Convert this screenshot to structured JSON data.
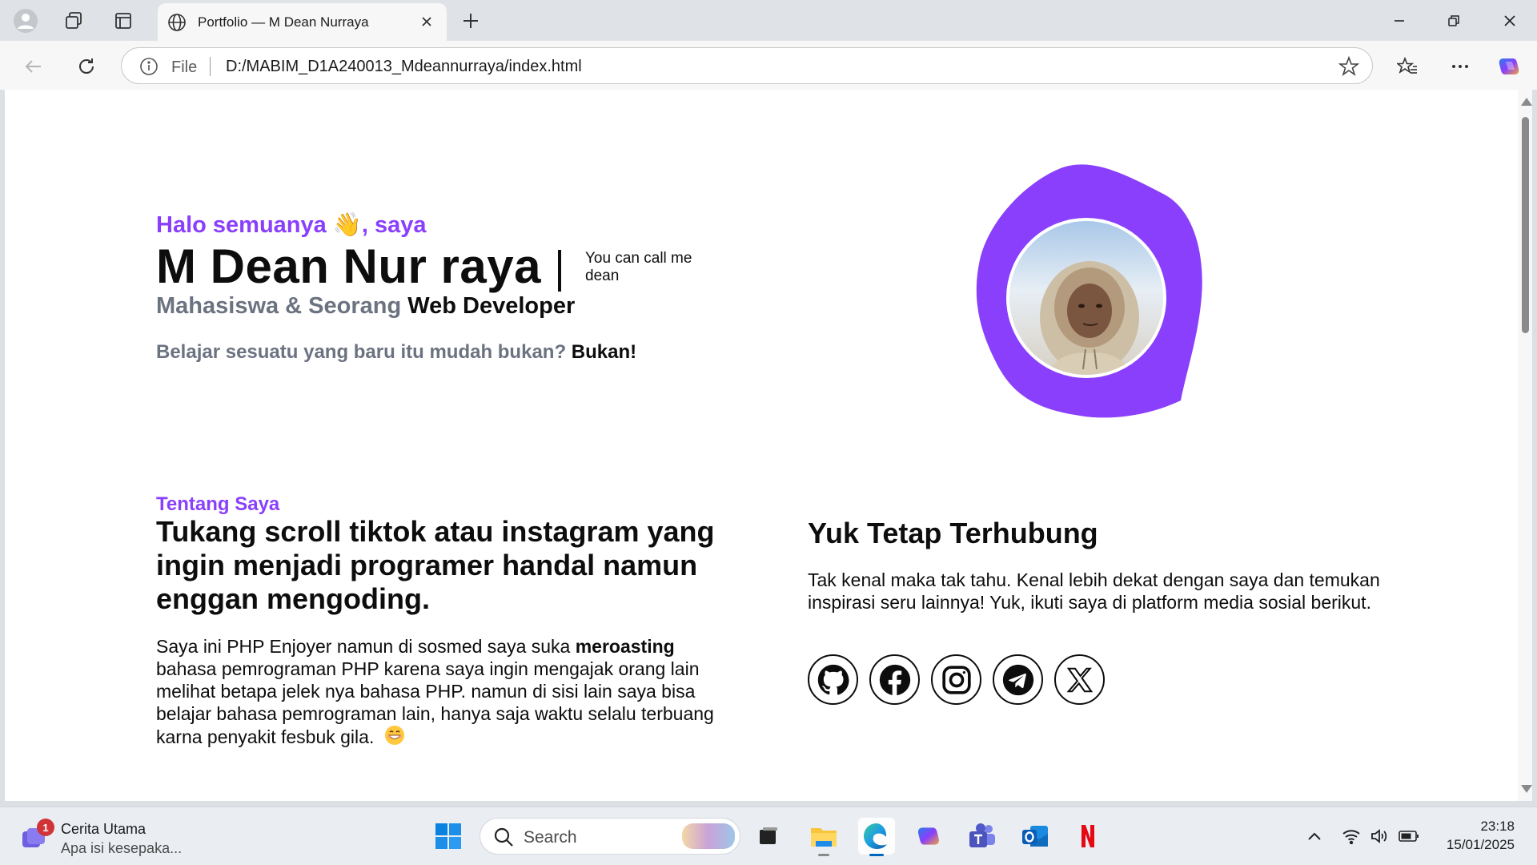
{
  "browser": {
    "tab_title": "Portfolio — M Dean Nurraya",
    "address_scheme": "File",
    "url": "D:/MABIM_D1A240013_Mdeannurraya/index.html",
    "icons": [
      "profile-icon",
      "workspaces-icon",
      "tab-actions-icon",
      "globe-icon",
      "close-icon",
      "plus-icon",
      "minimize-icon",
      "restore-icon",
      "window-close-icon",
      "back-icon",
      "refresh-icon",
      "info-icon",
      "star-icon",
      "favorites-icon",
      "more-icon",
      "copilot-icon"
    ]
  },
  "hero": {
    "greeting": "Halo semuanya 👋, saya",
    "name": "M Dean Nur raya",
    "nickname": "You can call me dean",
    "role_prefix": "Mahasiswa & Seorang",
    "role_highlight": "Web Developer",
    "quote_prefix": "Belajar sesuatu yang baru itu mudah bukan?",
    "quote_highlight": "Bukan!",
    "accent_color": "#8a3ffc"
  },
  "about": {
    "label": "Tentang Saya",
    "title": "Tukang scroll tiktok atau instagram yang ingin menjadi programer handal namun enggan mengoding.",
    "body_part1": "Saya ini PHP Enjoyer namun di sosmed saya suka",
    "body_bold": "meroasting",
    "body_part2": "bahasa pemrograman PHP karena saya ingin mengajak orang lain melihat betapa jelek nya bahasa PHP. namun di sisi lain saya bisa belajar bahasa pemrograman lain, hanya saja waktu selalu terbuang karna penyakit fesbuk gila."
  },
  "connect": {
    "title": "Yuk Tetap Terhubung",
    "body": "Tak kenal maka tak tahu. Kenal lebih dekat dengan saya dan temukan inspirasi seru lainnya! Yuk, ikuti saya di platform media sosial berikut.",
    "socials": [
      "github-icon",
      "facebook-icon",
      "instagram-icon",
      "telegram-icon",
      "x-icon"
    ]
  },
  "taskbar": {
    "news_title": "Cerita Utama",
    "news_subtitle": "Apa isi kesepaka...",
    "news_badge": "1",
    "search_placeholder": "Search",
    "time": "23:18",
    "date": "15/01/2025"
  }
}
